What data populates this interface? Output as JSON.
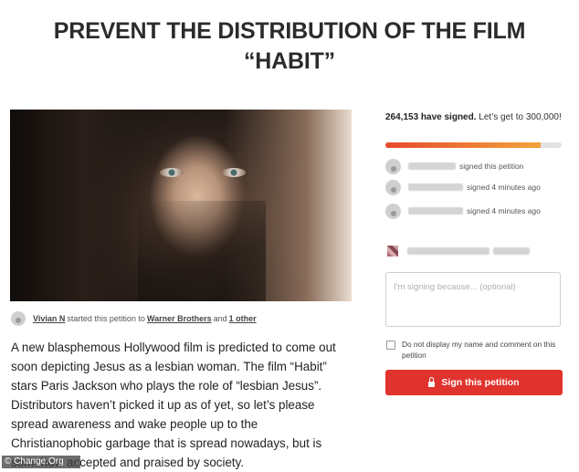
{
  "petition": {
    "title": "PREVENT THE DISTRIBUTION OF THE FILM “HABIT”",
    "starter": {
      "name": "Vivian N",
      "started_text": "started this petition to",
      "target": "Warner Brothers",
      "and_text": "and",
      "others": "1 other"
    },
    "description": "A new blasphemous Hollywood film is predicted to come out soon depicting Jesus as a lesbian woman. The film “Habit” stars Paris Jackson who plays the role of “lesbian Jesus”. Distributors haven’t picked it up as of yet, so let’s please spread awareness and wake people up to the Christianophobic garbage that is spread nowadays, but is somehow accepted and praised by society."
  },
  "signatures": {
    "count_text": "264,153 have signed.",
    "goal_text": "Let’s get to 300,000!",
    "progress": 0.88,
    "recent": [
      {
        "action": "signed this petition"
      },
      {
        "action": "signed 4 minutes ago"
      },
      {
        "action": "signed 4 minutes ago"
      }
    ]
  },
  "form": {
    "comment_placeholder": "I'm signing because... (optional)",
    "hide_name_label": "Do not display my name and comment on this petition",
    "sign_button": "Sign this petition"
  },
  "watermark": "© Change.Org",
  "colors": {
    "accent": "#e1332e",
    "progress_start": "#e8492c",
    "progress_end": "#f2a33a"
  }
}
